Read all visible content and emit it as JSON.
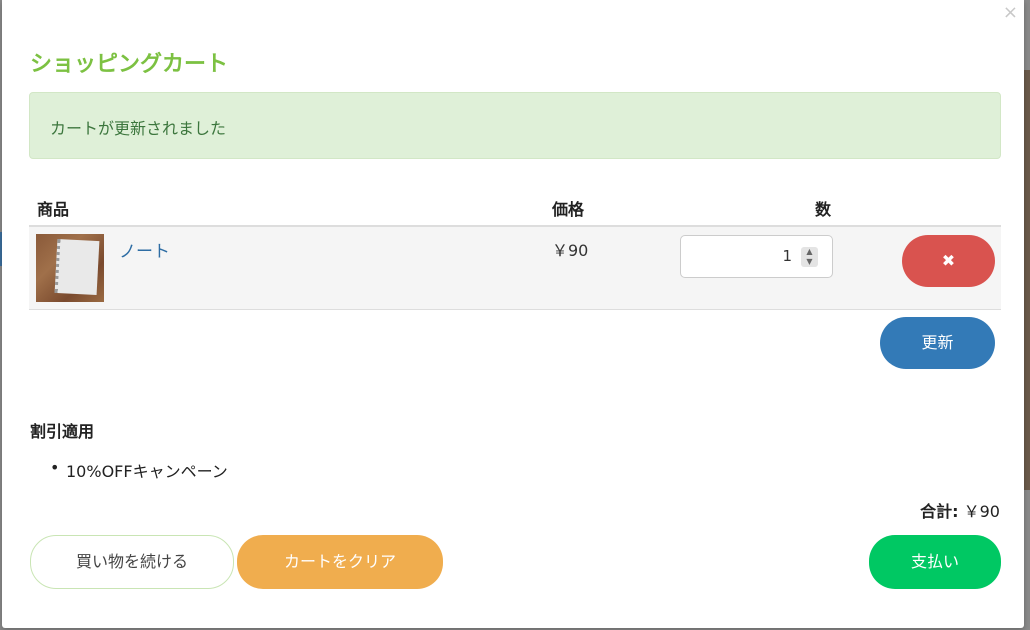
{
  "modal": {
    "close_glyph": "×",
    "title": "ショッピングカート",
    "alert_message": "カートが更新されました"
  },
  "table": {
    "headers": {
      "product": "商品",
      "price": "価格",
      "quantity": "数"
    },
    "items": [
      {
        "name": "ノート",
        "price": "￥90",
        "quantity": "1",
        "remove_glyph": "✖"
      }
    ]
  },
  "actions": {
    "update_label": "更新",
    "continue_label": "買い物を続ける",
    "clear_label": "カートをクリア",
    "pay_label": "支払い"
  },
  "discount": {
    "title": "割引適用",
    "items": [
      "10%OFFキャンペーン"
    ]
  },
  "summary": {
    "total_label": "合計:",
    "total_value": "￥90"
  },
  "colors": {
    "title": "#7cc142",
    "alert_bg": "#dff0d8",
    "remove": "#d9534f",
    "update": "#337ab7",
    "clear": "#f0ad4e",
    "pay": "#00c863"
  }
}
